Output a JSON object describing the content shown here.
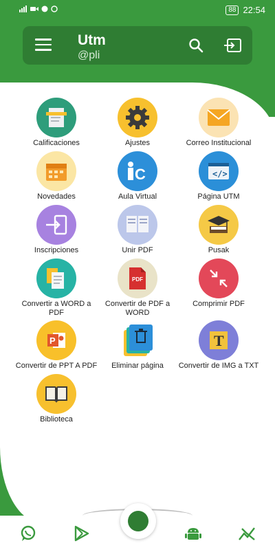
{
  "status": {
    "left_icons": "signal, wifi, video, battery-saver",
    "battery": "88",
    "time": "22:54"
  },
  "header": {
    "title": "Utm",
    "subtitle": "@pli"
  },
  "grid": [
    {
      "label": "Calificaciones",
      "bg": "#2e9d7b",
      "icon": "grades-icon"
    },
    {
      "label": "Ajustes",
      "bg": "#f7c02e",
      "icon": "gear-icon"
    },
    {
      "label": "Correo Institucional",
      "bg": "#fbe3b3",
      "icon": "mail-icon"
    },
    {
      "label": "Novedades",
      "bg": "#fbe6a4",
      "icon": "calendar-icon"
    },
    {
      "label": "Aula Virtual",
      "bg": "#2c8fd9",
      "icon": "virtual-classroom-icon"
    },
    {
      "label": "Página UTM",
      "bg": "#2b8fd8",
      "icon": "code-browser-icon"
    },
    {
      "label": "Inscripciones",
      "bg": "#a782e0",
      "icon": "login-icon"
    },
    {
      "label": "Unir PDF",
      "bg": "#bcc7ea",
      "icon": "merge-pdf-icon"
    },
    {
      "label": "Pusak",
      "bg": "#f5c946",
      "icon": "graduation-book-icon"
    },
    {
      "label": "Convertir a WORD a PDF",
      "bg": "#27b3a5",
      "icon": "word-to-pdf-icon"
    },
    {
      "label": "Convertir de PDF a WORD",
      "bg": "#e9e3c8",
      "icon": "pdf-to-word-icon"
    },
    {
      "label": "Comprimir PDF",
      "bg": "#e34859",
      "icon": "compress-icon"
    },
    {
      "label": "Convertir de PPT A PDF",
      "bg": "#f8c02a",
      "icon": "ppt-icon"
    },
    {
      "label": "Eliminar página",
      "bg": "#ffffff",
      "icon": "trash-icon"
    },
    {
      "label": "Convertir de IMG a TXT",
      "bg": "#7e7fd8",
      "icon": "text-icon"
    },
    {
      "label": "Biblioteca",
      "bg": "#f7c02e",
      "icon": "book-icon"
    }
  ],
  "bottom_nav": [
    "whatsapp-icon",
    "play-store-icon",
    "home-fab",
    "android-icon",
    "chart-icon"
  ]
}
